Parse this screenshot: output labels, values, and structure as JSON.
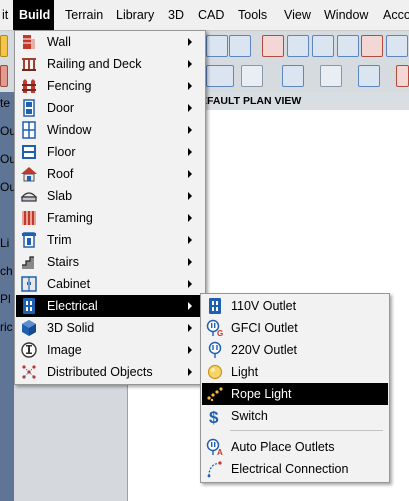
{
  "menubar": {
    "items": [
      {
        "label": "it"
      },
      {
        "label": "Build"
      },
      {
        "label": "Terrain"
      },
      {
        "label": "Library"
      },
      {
        "label": "3D"
      },
      {
        "label": "CAD"
      },
      {
        "label": "Tools"
      },
      {
        "label": "View"
      },
      {
        "label": "Window"
      },
      {
        "label": "Acco"
      }
    ]
  },
  "view": {
    "title": "EFAULT PLAN VIEW"
  },
  "left_panel": {
    "fragments": [
      "te",
      "Ou",
      "Ou",
      "Ou",
      "Li",
      "ch",
      "Pl",
      "ric"
    ]
  },
  "build_menu": {
    "items": [
      {
        "label": "Wall",
        "icon": "wall-icon",
        "submenu": true
      },
      {
        "label": "Railing and Deck",
        "icon": "railing-icon",
        "submenu": true
      },
      {
        "label": "Fencing",
        "icon": "fencing-icon",
        "submenu": true
      },
      {
        "label": "Door",
        "icon": "door-icon",
        "submenu": true
      },
      {
        "label": "Window",
        "icon": "window-icon",
        "submenu": true
      },
      {
        "label": "Floor",
        "icon": "floor-icon",
        "submenu": true
      },
      {
        "label": "Roof",
        "icon": "roof-icon",
        "submenu": true
      },
      {
        "label": "Slab",
        "icon": "slab-icon",
        "submenu": true
      },
      {
        "label": "Framing",
        "icon": "framing-icon",
        "submenu": true
      },
      {
        "label": "Trim",
        "icon": "trim-icon",
        "submenu": true
      },
      {
        "label": "Stairs",
        "icon": "stairs-icon",
        "submenu": true
      },
      {
        "label": "Cabinet",
        "icon": "cabinet-icon",
        "submenu": true
      },
      {
        "label": "Electrical",
        "icon": "electrical-icon",
        "submenu": true,
        "highlighted": true
      },
      {
        "label": "3D Solid",
        "icon": "solid-3d-icon",
        "submenu": true
      },
      {
        "label": "Image",
        "icon": "image-icon",
        "submenu": true
      },
      {
        "label": "Distributed Objects",
        "icon": "distributed-objects-icon",
        "submenu": true
      }
    ]
  },
  "electrical_menu": {
    "items": [
      {
        "label": "110V Outlet",
        "icon": "outlet-110v-icon"
      },
      {
        "label": "GFCI Outlet",
        "icon": "gfci-outlet-icon"
      },
      {
        "label": "220V Outlet",
        "icon": "outlet-220v-icon"
      },
      {
        "label": "Light",
        "icon": "light-bulb-icon"
      },
      {
        "label": "Rope Light",
        "icon": "rope-light-icon",
        "highlighted": true
      },
      {
        "label": "Switch",
        "icon": "switch-icon"
      },
      {
        "label": "Auto Place Outlets",
        "icon": "auto-place-outlets-icon"
      },
      {
        "label": "Electrical Connection",
        "icon": "electrical-connection-icon"
      }
    ]
  },
  "colors": {
    "menu_bg": "#f2f2f2",
    "highlight_bg": "#000000",
    "highlight_text": "#ffffff",
    "accent_blue": "#1f5fb0",
    "accent_red": "#c0392b"
  }
}
